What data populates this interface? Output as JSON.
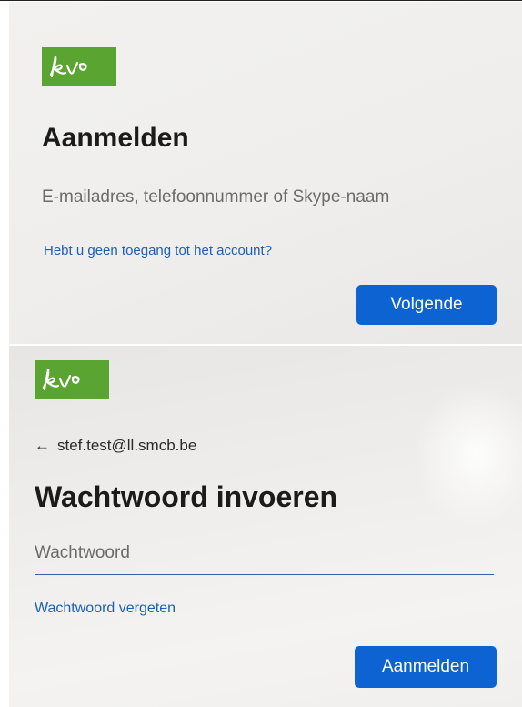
{
  "brand": {
    "logo_text": "kvo",
    "color": "#5aa532"
  },
  "step1": {
    "title": "Aanmelden",
    "email_placeholder": "E-mailadres, telefoonnummer of Skype-naam",
    "email_value": "",
    "no_access_link": "Hebt u geen toegang tot het account?",
    "next_button": "Volgende"
  },
  "step2": {
    "back_icon": "back-arrow-icon",
    "account": "stef.test@ll.smcb.be",
    "title": "Wachtwoord invoeren",
    "password_placeholder": "Wachtwoord",
    "password_value": "",
    "forgot_link": "Wachtwoord vergeten",
    "signin_button": "Aanmelden"
  },
  "colors": {
    "accent": "#0c63d1",
    "link": "#1b5fb4"
  }
}
